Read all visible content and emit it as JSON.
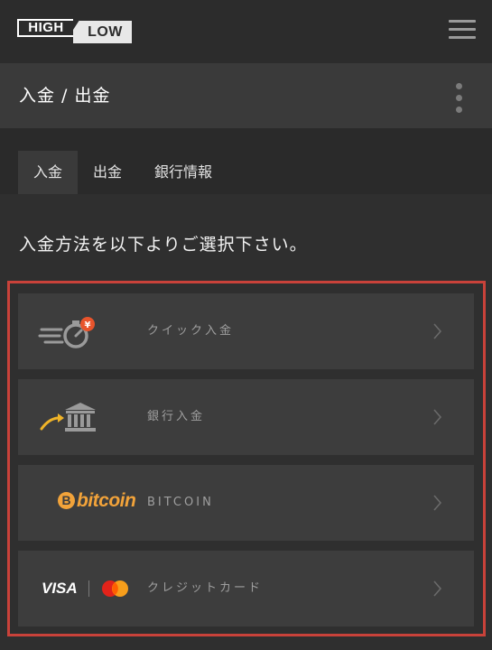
{
  "header": {
    "logo_high": "HIGH",
    "logo_low": "LOW",
    "menu_icon": "hamburger-menu-icon"
  },
  "page": {
    "title": "入金 / 出金",
    "more_icon": "vertical-dots-icon"
  },
  "tabs": [
    {
      "label": "入金",
      "active": true
    },
    {
      "label": "出金",
      "active": false
    },
    {
      "label": "銀行情報",
      "active": false
    }
  ],
  "instruction": "入金方法を以下よりご選択下さい。",
  "methods": [
    {
      "label": "クイック入金",
      "icon": "quick-deposit-stopwatch-yen-icon"
    },
    {
      "label": "銀行入金",
      "icon": "bank-building-icon"
    },
    {
      "label": "BITCOIN",
      "icon": "bitcoin-logo",
      "logo_text": "bitcoin",
      "coin_symbol": "B"
    },
    {
      "label": "クレジットカード",
      "icon": "visa-mastercard-logo",
      "visa_text": "VISA"
    }
  ],
  "colors": {
    "accent_border": "#c9423a",
    "bitcoin_orange": "#f2a33a",
    "quick_badge": "#e8542c",
    "arrow_gold": "#f0b428"
  }
}
